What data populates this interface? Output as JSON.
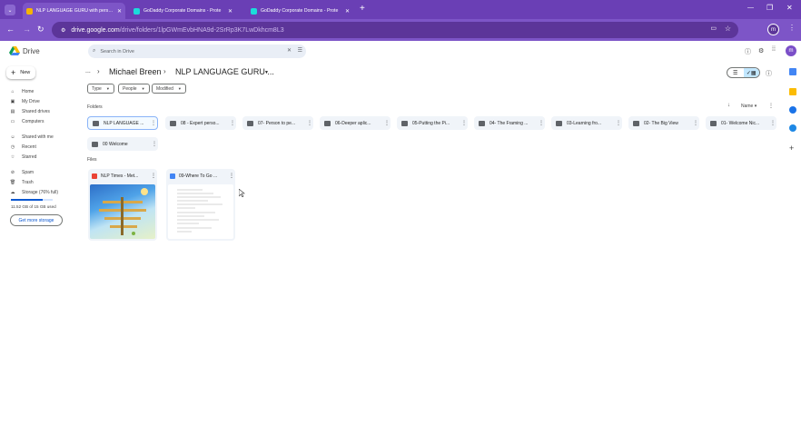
{
  "browser": {
    "tabs": [
      {
        "label": "NLP LANGUAGE GURU with persona",
        "color": "#f6b400"
      },
      {
        "label": "GoDaddy Corporate Domains - Prote",
        "color": "#1bdbdb"
      },
      {
        "label": "GoDaddy Corporate Domains - Prote",
        "color": "#1bdbdb"
      }
    ],
    "url_host": "drive.google.com",
    "url_path": "/drive/folders/1lpGWmEvbHNA9d-2SrRp3K7LwDkhcm8L3",
    "profile_initial": "m"
  },
  "app": {
    "name": "Drive",
    "search_placeholder": "Search in Drive",
    "avatar_initial": "m"
  },
  "sidebar": {
    "new_label": "New",
    "items": [
      {
        "label": "Home",
        "icon": "home-icon"
      },
      {
        "label": "My Drive",
        "icon": "my-drive-icon"
      },
      {
        "label": "Shared drives",
        "icon": "shared-drives-icon"
      },
      {
        "label": "Computers",
        "icon": "computers-icon"
      },
      {
        "label": "Shared with me",
        "icon": "shared-with-me-icon"
      },
      {
        "label": "Recent",
        "icon": "recent-icon"
      },
      {
        "label": "Starred",
        "icon": "starred-icon"
      },
      {
        "label": "Spam",
        "icon": "spam-icon"
      },
      {
        "label": "Trash",
        "icon": "trash-icon"
      },
      {
        "label": "Storage (76% full)",
        "icon": "storage-icon"
      }
    ],
    "storage_used": "11.52 GB of 15 GB used",
    "storage_fraction": 0.76,
    "get_more_label": "Get more storage"
  },
  "breadcrumb": {
    "ellipsis": "...",
    "parent": "Michael Breen",
    "current": "NLP LANGUAGE GURU ..."
  },
  "filters": [
    "Type",
    "People",
    "Modified"
  ],
  "sort": {
    "label": "Name"
  },
  "sections": {
    "folders": "Folders",
    "files": "Files"
  },
  "folders": [
    "NLP LANGUAGE ...",
    "08 - Expert perso...",
    "07- Person to pe...",
    "06-Deeper aplic...",
    "05-Putting the Pi...",
    "04- The Framing ...",
    "03-Learning fro...",
    "02- The Big View",
    "01- Welcome Nic...",
    "00 Welcome"
  ],
  "files": [
    {
      "name": "NLP Times - Met...",
      "type": "pdf",
      "color": "#ea4335"
    },
    {
      "name": "09-Where To Go ...",
      "type": "doc",
      "color": "#4285f4"
    }
  ]
}
